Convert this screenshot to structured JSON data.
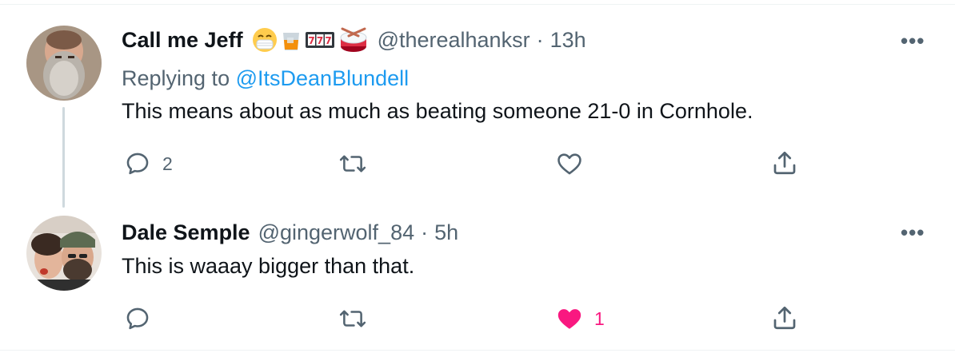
{
  "tweets": [
    {
      "name": "Call me Jeff",
      "emojis": [
        "mask-face-emoji",
        "whisky-glass-emoji",
        "slot-777-emoji",
        "drum-emoji"
      ],
      "handle": "@therealhanksr",
      "sep": "·",
      "time": "13h",
      "replying_prefix": "Replying to",
      "replying_handle": "@ItsDeanBlundell",
      "text": "This means about as much as beating someone 21-0 in Cornhole.",
      "more": "•••",
      "reply_count": "2",
      "retweet_count": "",
      "like_count": "",
      "liked": false
    },
    {
      "name": "Dale Semple",
      "handle": "@gingerwolf_84",
      "sep": "·",
      "time": "5h",
      "text": "This is waaay bigger than that.",
      "more": "•••",
      "reply_count": "",
      "retweet_count": "",
      "like_count": "1",
      "liked": true
    }
  ],
  "colors": {
    "text": "#0f1419",
    "secondary": "#536471",
    "link": "#1d9bf0",
    "like": "#f91880",
    "thread_line": "#cfd9de"
  }
}
